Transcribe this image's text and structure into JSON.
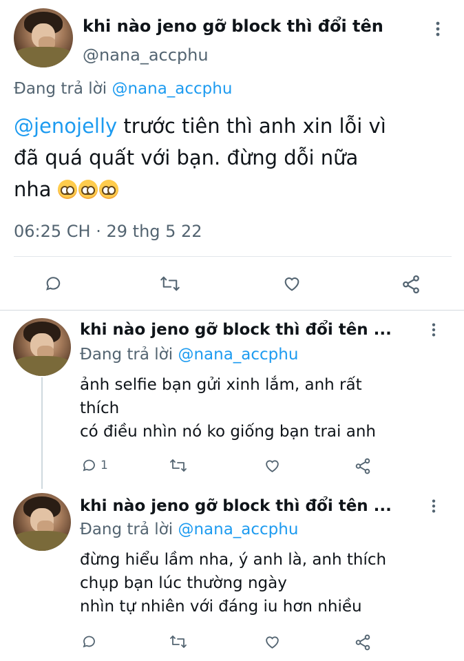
{
  "main_tweet": {
    "display_name": "khi nào jeno gỡ block thì đổi tên",
    "handle": "@nana_accphu",
    "replying_prefix": "Đang trả lời",
    "replying_to": "@nana_accphu",
    "mention": "@jenojelly",
    "text": " trước tiên thì anh xin lỗi vì\nđã quá quất với bạn. đừng dỗi nữa\nnha ",
    "emoji": [
      "pleading-face",
      "pleading-face",
      "pleading-face"
    ],
    "timestamp": "06:25 CH · 29 thg 5 22"
  },
  "replies": [
    {
      "display_name": "khi nào jeno gỡ block thì đổi tên ...",
      "replying_prefix": "Đang trả lời",
      "replying_to": "@nana_accphu",
      "text": "ảnh selfie bạn gửi xinh lắm, anh rất\nthích\ncó điều nhìn nó ko giống bạn trai anh",
      "reply_count": "1"
    },
    {
      "display_name": "khi nào jeno gỡ block thì đổi tên ...",
      "replying_prefix": "Đang trả lời",
      "replying_to": "@nana_accphu",
      "text": "đừng hiểu lầm nha, ý anh là, anh thích\nchụp bạn lúc thường ngày\nnhìn tự nhiên với đáng iu hơn nhiều",
      "reply_count": ""
    }
  ],
  "icons": {
    "reply": "reply-icon",
    "retweet": "retweet-icon",
    "like": "heart-icon",
    "share": "share-icon",
    "more": "more-vertical-icon"
  },
  "colors": {
    "link": "#1d9bf0",
    "secondary": "#536471",
    "text": "#0f1419"
  }
}
